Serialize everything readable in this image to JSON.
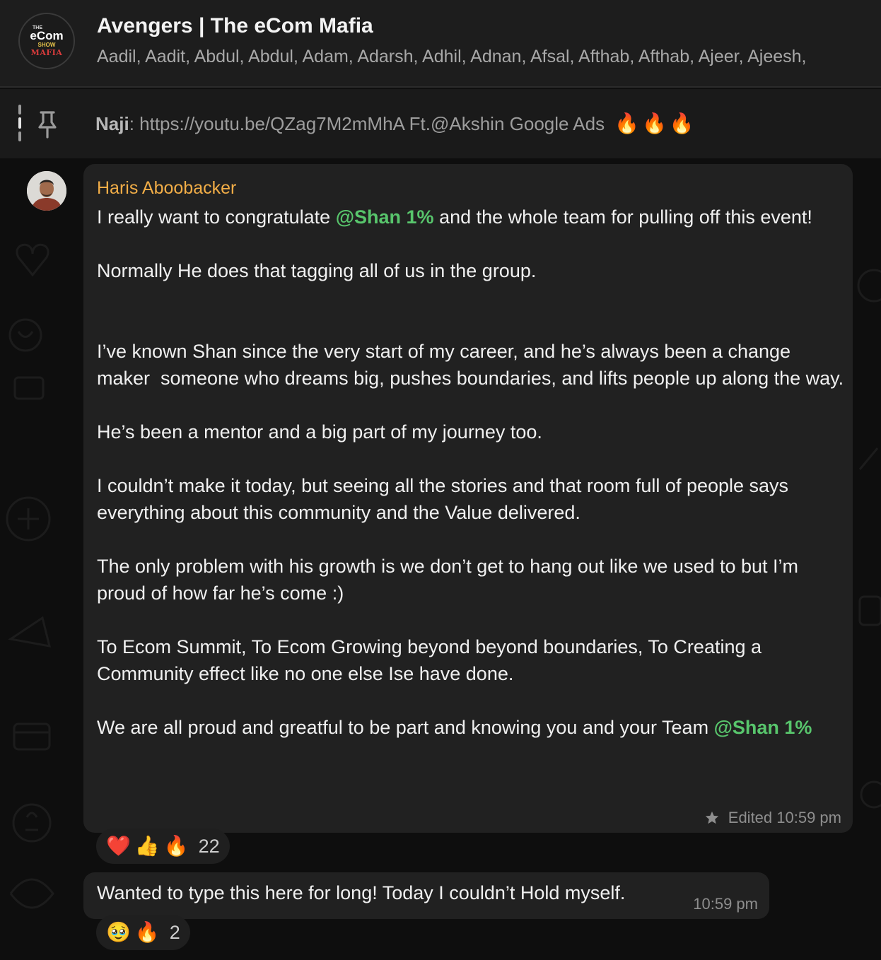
{
  "header": {
    "logo": {
      "the": "THE",
      "ecom": "eCom",
      "show": "SHOW",
      "mafia": "MAFIA"
    },
    "title": "Avengers | The eCom Mafia",
    "members": "Aadil, Aadit, Abdul, Abdul, Adam, Adarsh, Adhil, Adnan, Afsal, Afthab, Afthab, Ajeer, Ajeesh,"
  },
  "pinned": {
    "sender": "Naji",
    "separator": ": ",
    "text": "https://youtu.be/QZag7M2mMhA Ft.@Akshin Google Ads",
    "emoji": "🔥🔥🔥"
  },
  "messages": [
    {
      "sender": "Haris Aboobacker",
      "segments": [
        {
          "type": "text",
          "value": "I really want to congratulate "
        },
        {
          "type": "mention",
          "value": "@Shan 1%"
        },
        {
          "type": "text",
          "value": " and the whole team for pulling off this event!\n\nNormally He does that tagging all of us in the group.\n\n\nI’ve known Shan since the very start of my career, and he’s always been a change maker  someone who dreams big, pushes boundaries, and lifts people up along the way.\n\nHe’s been a mentor and a big part of my journey too.\n\nI couldn’t make it today, but seeing all the stories and that room full of people says everything about this community and the Value delivered.\n\nThe only problem with his growth is we don’t get to hang out like we used to but I’m proud of how far he’s come :)\n\nTo Ecom Summit, To Ecom Growing beyond beyond boundaries, To Creating a Community effect like no one else Ise have done.\n\nWe are all proud and greatful to be part and knowing you and your Team "
        },
        {
          "type": "mention",
          "value": "@Shan 1%"
        }
      ],
      "meta": "Edited 10:59 pm",
      "reactions": {
        "emoji": [
          "❤️",
          "👍",
          "🔥"
        ],
        "count": "22"
      }
    },
    {
      "text": "Wanted to type this here for long! Today I couldn’t Hold myself.",
      "time": "10:59 pm",
      "reactions": {
        "emoji": [
          "🥹",
          "🔥"
        ],
        "count": "2"
      }
    }
  ],
  "colors": {
    "sender_name": "#f1ad47",
    "mention": "#58c56c",
    "bubble": "#212121",
    "header_bg": "#1d1d1d"
  },
  "icons": [
    "pin-icon",
    "star-icon"
  ]
}
